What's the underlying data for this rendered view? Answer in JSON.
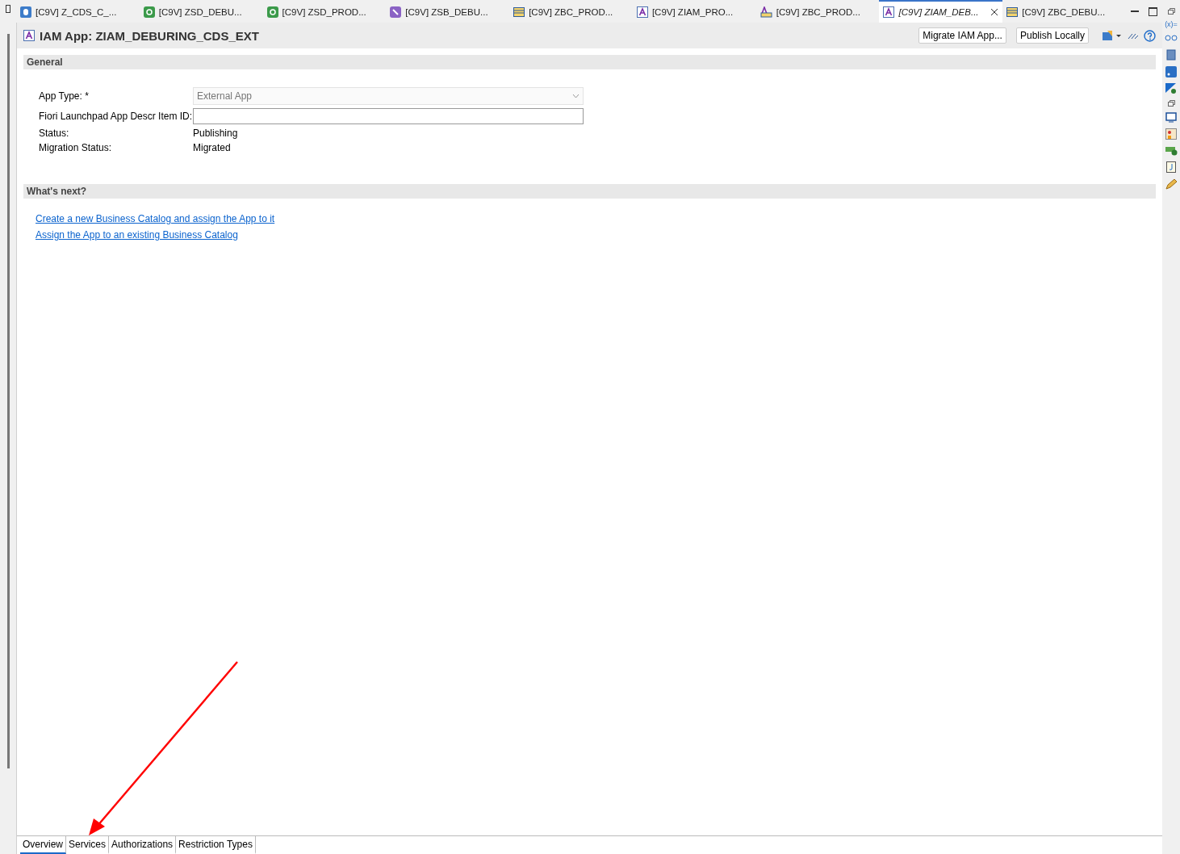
{
  "editor_tabs": [
    {
      "label": "[C9V] Z_CDS_C_...",
      "kind": "ddic",
      "selected": false
    },
    {
      "label": "[C9V] ZSD_DEBU...",
      "kind": "service",
      "selected": false
    },
    {
      "label": "[C9V] ZSD_PROD...",
      "kind": "service",
      "selected": false
    },
    {
      "label": "[C9V] ZSB_DEBU...",
      "kind": "binding",
      "selected": false
    },
    {
      "label": "[C9V] ZBC_PROD...",
      "kind": "table",
      "selected": false
    },
    {
      "label": "[C9V] ZIAM_PRO...",
      "kind": "iam",
      "selected": false
    },
    {
      "label": "[C9V] ZBC_PROD...",
      "kind": "catalog",
      "selected": false
    },
    {
      "label": "[C9V] ZIAM_DEB...",
      "kind": "iam",
      "selected": true
    },
    {
      "label": "[C9V] ZBC_DEBU...",
      "kind": "table",
      "selected": false
    }
  ],
  "editor": {
    "title": "IAM App: ZIAM_DEBURING_CDS_EXT",
    "actions": [
      {
        "label": "Migrate IAM App..."
      },
      {
        "label": "Publish Locally"
      }
    ],
    "sections": [
      {
        "kind": "form",
        "title": "General",
        "fields": [
          {
            "kind": "dropdown",
            "label": "App Type: *",
            "value": "External App",
            "disabled": true
          },
          {
            "kind": "input",
            "label": "Fiori Launchpad App Descr Item ID:"
          },
          {
            "kind": "text",
            "label": "Status:",
            "value": "Publishing"
          },
          {
            "kind": "text",
            "label": "Migration Status:",
            "value": "Migrated"
          }
        ]
      },
      {
        "kind": "links",
        "title": "What's next?",
        "links": [
          "Create a new Business Catalog and assign the App to it",
          "Assign the App to an existing Business Catalog"
        ]
      }
    ],
    "page_tabs": [
      {
        "label": "Overview",
        "selected": true
      },
      {
        "label": "Services",
        "selected": false
      },
      {
        "label": "Authorizations",
        "selected": false
      },
      {
        "label": "Restriction Types",
        "selected": false
      }
    ]
  },
  "side_toolbar": {
    "variables_label": "(x)="
  }
}
